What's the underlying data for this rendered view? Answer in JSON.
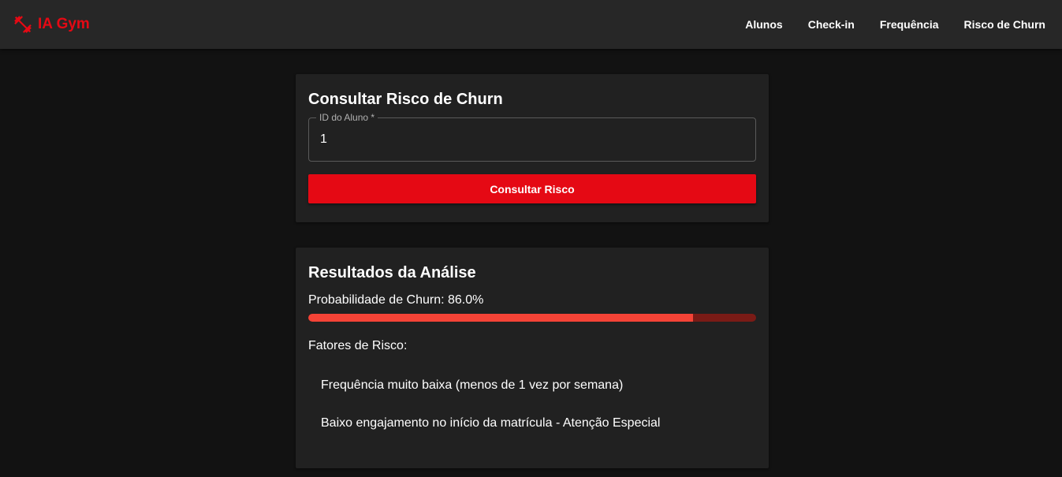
{
  "brand": {
    "name": "IA Gym",
    "icon": "dumbbell-icon",
    "color": "#e50914"
  },
  "nav": {
    "items": [
      {
        "label": "Alunos"
      },
      {
        "label": "Check-in"
      },
      {
        "label": "Frequência"
      },
      {
        "label": "Risco de Churn"
      }
    ]
  },
  "query_card": {
    "title": "Consultar Risco de Churn",
    "field": {
      "label": "ID do Aluno *",
      "value": "1"
    },
    "submit_label": "Consultar Risco"
  },
  "results_card": {
    "title": "Resultados da Análise",
    "probability_label": "Probabilidade de Churn: 86.0%",
    "probability_value": 86.0,
    "factors_title": "Fatores de Risco:",
    "factors": [
      "Frequência muito baixa (menos de 1 vez por semana)",
      "Baixo engajamento no início da matrícula - Atenção Especial"
    ]
  },
  "colors": {
    "accent": "#e50914",
    "progress_fill": "#f44336",
    "progress_track": "#7a1b16",
    "background": "#121212",
    "card": "#212121",
    "navbar": "#272727"
  }
}
